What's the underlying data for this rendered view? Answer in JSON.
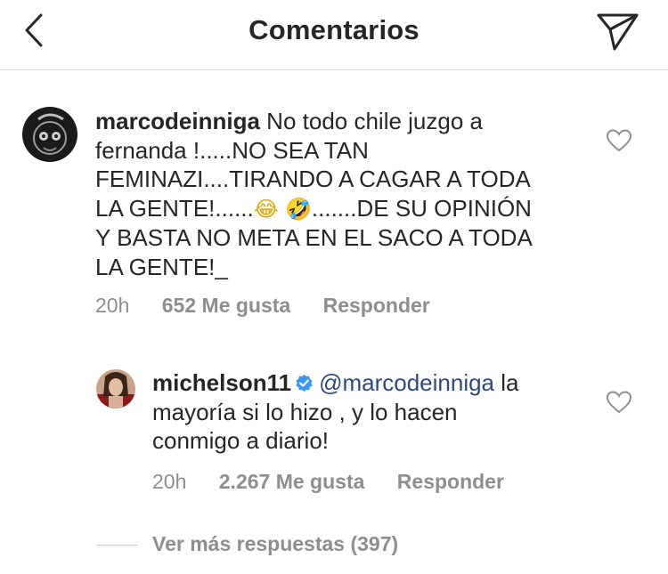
{
  "header": {
    "title": "Comentarios",
    "back_icon": "chevron-left-icon",
    "send_icon": "paper-plane-icon"
  },
  "comment": {
    "username": "marcodeinniga",
    "lines": [
      "No todo chile juzgo a",
      "fernanda !.....NO SEA TAN",
      "FEMINAZI....TIRANDO A CAGAR A TODA",
      "LA GENTE!......",
      "Y BASTA NO META EN EL SACO A TODA",
      "LA GENTE!_"
    ],
    "emoji_1": "😂",
    "emoji_2": "🤣",
    "line4_tail": ".......DE SU OPINIÓN",
    "time": "20h",
    "likes": "652 Me gusta",
    "reply_label": "Responder"
  },
  "reply": {
    "username": "michelson11",
    "verified": true,
    "mention": "@marcodeinniga",
    "line1_tail": "la",
    "lines": [
      "mayoría si lo hizo , y lo hacen",
      "conmigo a diario!"
    ],
    "time": "20h",
    "likes": "2.267 Me gusta",
    "reply_label": "Responder"
  },
  "more_replies": {
    "label": "Ver más respuestas (397)"
  },
  "colors": {
    "text": "#262626",
    "muted": "#8e8e8e",
    "mention": "#2b4a7d",
    "verified": "#3897f0",
    "divider": "#dbdbdb"
  }
}
